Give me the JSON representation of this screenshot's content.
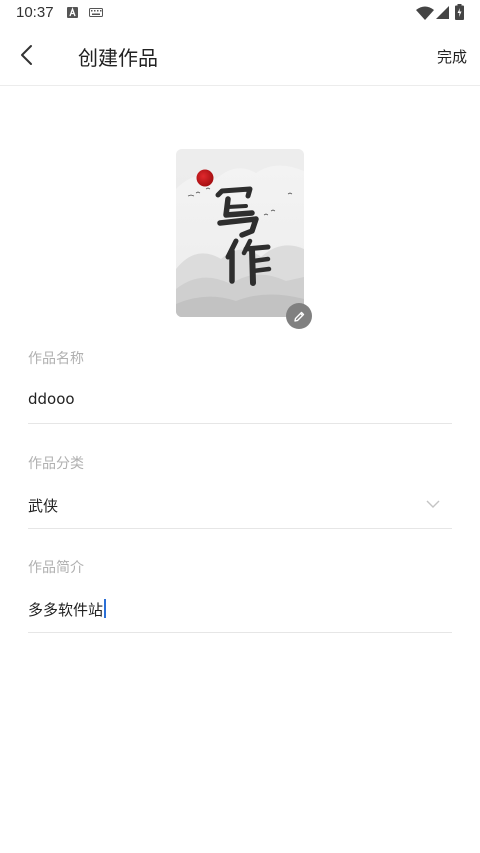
{
  "status_bar": {
    "time": "10:37"
  },
  "header": {
    "title": "创建作品",
    "done_label": "完成"
  },
  "cover": {
    "title_chars": "写作"
  },
  "form": {
    "name": {
      "label": "作品名称",
      "value": "ddooo"
    },
    "category": {
      "label": "作品分类",
      "value": "武侠"
    },
    "intro": {
      "label": "作品简介",
      "value": "多多软件站"
    }
  },
  "colors": {
    "accent_cursor": "#2b6fd6",
    "label_gray": "#b0b0b0",
    "divider": "#e6e6e6",
    "sun_red": "#c0161b"
  }
}
